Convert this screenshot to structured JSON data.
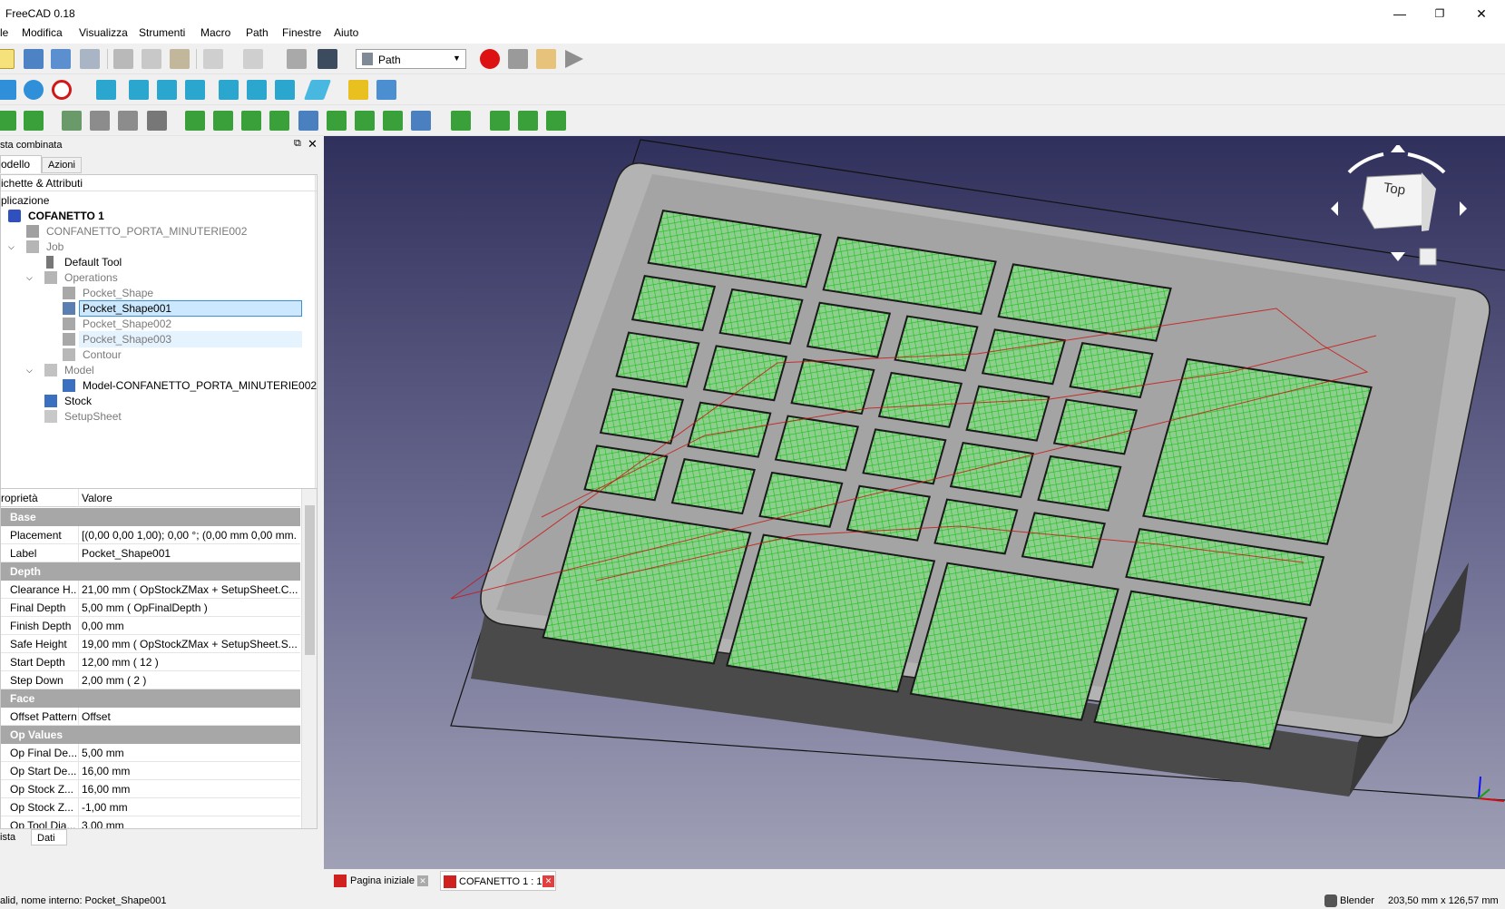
{
  "window": {
    "title": "FreeCAD 0.18",
    "minimize": "—",
    "restore": "❐",
    "close": "✕"
  },
  "menu": [
    "le",
    "Modifica",
    "Visualizza",
    "Strumenti",
    "Macro",
    "Path",
    "Finestre",
    "Aiuto"
  ],
  "workbench": {
    "selected": "Path"
  },
  "combo_view": {
    "title": "sta combinata",
    "tabs": [
      "odello",
      "Azioni"
    ],
    "tree_header": "ichette & Attributi",
    "tree": [
      {
        "label": "plicazione",
        "state": "normal"
      },
      {
        "label": "COFANETTO 1",
        "state": "bold"
      },
      {
        "label": "CONFANETTO_PORTA_MINUTERIE002",
        "state": "grey"
      },
      {
        "label": "Job",
        "state": "grey"
      },
      {
        "label": "Default Tool",
        "state": "normal"
      },
      {
        "label": "Operations",
        "state": "grey"
      },
      {
        "label": "Pocket_Shape",
        "state": "grey"
      },
      {
        "label": "Pocket_Shape001",
        "state": "selected"
      },
      {
        "label": "Pocket_Shape002",
        "state": "grey"
      },
      {
        "label": "Pocket_Shape003",
        "state": "grey-hover"
      },
      {
        "label": "Contour",
        "state": "grey"
      },
      {
        "label": "Model",
        "state": "grey"
      },
      {
        "label": "Model-CONFANETTO_PORTA_MINUTERIE002",
        "state": "normal"
      },
      {
        "label": "Stock",
        "state": "normal"
      },
      {
        "label": "SetupSheet",
        "state": "grey"
      }
    ]
  },
  "properties": {
    "header_key": "roprietà",
    "header_value": "Valore",
    "groups": [
      {
        "name": "Base",
        "rows": [
          {
            "k": "Placement",
            "v": "[(0,00 0,00 1,00); 0,00 °; (0,00 mm  0,00 mm..."
          },
          {
            "k": "Label",
            "v": "Pocket_Shape001"
          }
        ]
      },
      {
        "name": "Depth",
        "rows": [
          {
            "k": "Clearance H...",
            "v": "21,00 mm  ( OpStockZMax + SetupSheet.C..."
          },
          {
            "k": "Final Depth",
            "v": "5,00 mm  ( OpFinalDepth )"
          },
          {
            "k": "Finish Depth",
            "v": "0,00 mm"
          },
          {
            "k": "Safe Height",
            "v": "19,00 mm  ( OpStockZMax + SetupSheet.S..."
          },
          {
            "k": "Start Depth",
            "v": "12,00 mm  ( 12 )"
          },
          {
            "k": "Step Down",
            "v": "2,00 mm  ( 2 )"
          }
        ]
      },
      {
        "name": "Face",
        "rows": [
          {
            "k": "Offset Pattern",
            "v": "Offset"
          }
        ]
      },
      {
        "name": "Op Values",
        "rows": [
          {
            "k": "Op Final De...",
            "v": "5,00 mm"
          },
          {
            "k": "Op Start De...",
            "v": "16,00 mm"
          },
          {
            "k": "Op Stock Z...",
            "v": "16,00 mm"
          },
          {
            "k": "Op Stock Z...",
            "v": "-1,00 mm"
          },
          {
            "k": "Op Tool Dia...",
            "v": "3,00 mm"
          }
        ]
      }
    ],
    "tabs": [
      "ista",
      "Dati"
    ]
  },
  "navcube": {
    "face": "Top"
  },
  "doc_tabs": [
    "Pagina iniziale",
    "COFANETTO 1 : 1"
  ],
  "status": {
    "left": "alid, nome interno: Pocket_Shape001",
    "nav": "Blender",
    "dims": "203,50 mm x 126,57 mm"
  },
  "colors": {
    "accent_selected": "#cce8ff",
    "toolpath_green": "#17c517",
    "rapid_red": "#cc1010",
    "part_grey": "#b5b5b5"
  }
}
